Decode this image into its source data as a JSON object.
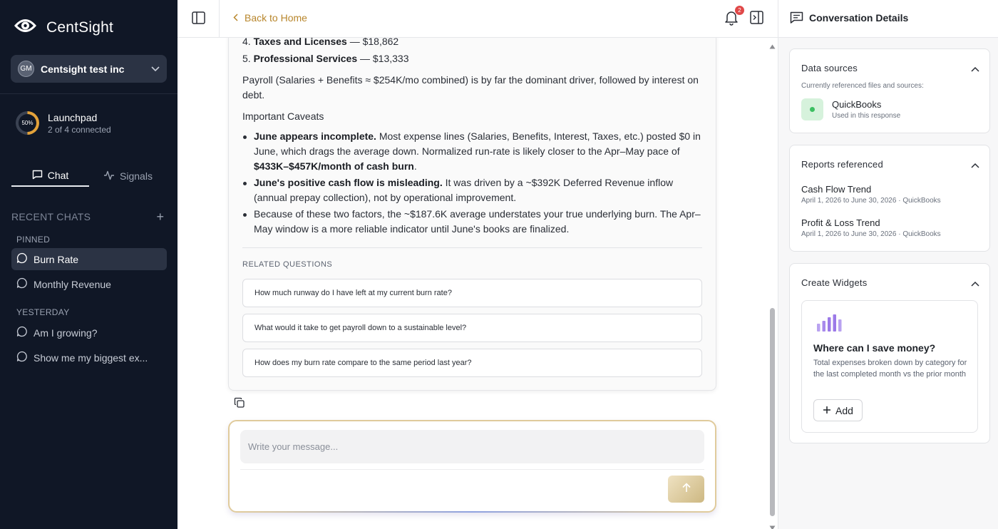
{
  "brand": {
    "name": "CentSight"
  },
  "org": {
    "initials": "GM",
    "name": "Centsight test inc"
  },
  "launchpad": {
    "percent": 50,
    "percent_label": "50%",
    "title": "Launchpad",
    "subtitle": "2 of 4 connected"
  },
  "tabs": [
    {
      "label": "Chat"
    },
    {
      "label": "Signals"
    }
  ],
  "recent": {
    "heading": "RECENT CHATS",
    "pinned_label": "PINNED",
    "pinned": [
      {
        "label": "Burn Rate"
      },
      {
        "label": "Monthly Revenue"
      }
    ],
    "yesterday_label": "YESTERDAY",
    "yesterday": [
      {
        "label": "Am I growing?"
      },
      {
        "label": "Show me my biggest ex..."
      }
    ]
  },
  "topbar": {
    "back_label": "Back to Home",
    "notifications": "2"
  },
  "message": {
    "list_item_4": {
      "num": "4.",
      "name": "Taxes and Licenses",
      "value": " — $18,862"
    },
    "list_item_5": {
      "num": "5.",
      "name": "Professional Services",
      "value": " — $13,333"
    },
    "summary": "Payroll (Salaries + Benefits ≈ $254K/mo combined) is by far the dominant driver, followed by interest on debt.",
    "caveats_heading": "Important Caveats",
    "caveat1_bold": "June appears incomplete.",
    "caveat1_text": " Most expense lines (Salaries, Benefits, Interest, Taxes, etc.) posted $0 in June, which drags the average down. Normalized run-rate is likely closer to the Apr–May pace of ",
    "caveat1_bold2": "$433K–$457K/month of cash burn",
    "caveat1_end": ".",
    "caveat2_bold": "June's positive cash flow is misleading.",
    "caveat2_text": " It was driven by a ~$392K Deferred Revenue inflow (annual prepay collection), not by operational improvement.",
    "caveat3_text": "Because of these two factors, the ~$187.6K average understates your true underlying burn. The Apr–May window is a more reliable indicator until June's books are finalized."
  },
  "related": {
    "label": "RELATED QUESTIONS",
    "questions": [
      "How much runway do I have left at my current burn rate?",
      "What would it take to get payroll down to a sustainable level?",
      "How does my burn rate compare to the same period last year?"
    ]
  },
  "composer": {
    "placeholder": "Write your message..."
  },
  "details": {
    "title": "Conversation Details",
    "data_sources": {
      "title": "Data sources",
      "subtitle": "Currently referenced files and sources:",
      "source_name": "QuickBooks",
      "source_sub": "Used in this response"
    },
    "reports": {
      "title": "Reports referenced",
      "items": [
        {
          "title": "Cash Flow Trend",
          "sub": "April 1, 2026 to June 30, 2026 · QuickBooks"
        },
        {
          "title": "Profit & Loss Trend",
          "sub": "April 1, 2026 to June 30, 2026 · QuickBooks"
        }
      ]
    },
    "widgets": {
      "title": "Create Widgets",
      "widget_title": "Where can I save money?",
      "widget_desc": "Total expenses broken down by category for the last completed month vs the prior month",
      "add_label": "Add"
    }
  },
  "colors": {
    "sidebar_bg": "#101726",
    "accent_gold": "#b8862c",
    "widget_icon": "#9c7ae8",
    "source_green": "#3cbf62"
  }
}
